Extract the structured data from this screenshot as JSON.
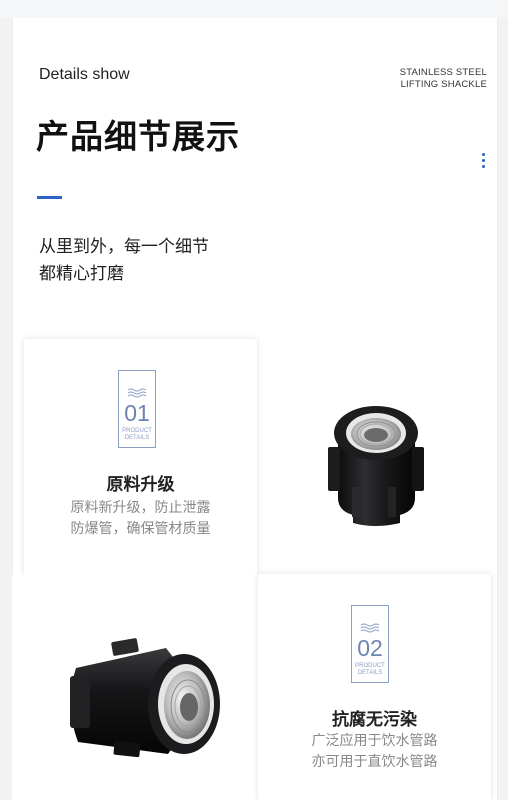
{
  "header": {
    "eyebrow": "Details show",
    "subtitle_line1": "STAINLESS STEEL",
    "subtitle_line2": "LIFTING SHACKLE",
    "title": "产品细节展示"
  },
  "tagline": {
    "line1": "从里到外，每一个细节",
    "line2": "都精心打磨"
  },
  "features": [
    {
      "number": "01",
      "caption_line1": "PRODUCT",
      "caption_line2": "DETAILS",
      "title": "原料升级",
      "desc_line1": "原料新升级，防止泄露",
      "desc_line2": "防爆管，确保管材质量"
    },
    {
      "number": "02",
      "caption_line1": "PRODUCT",
      "caption_line2": "DETAILS",
      "title": "抗腐无污染",
      "desc_line1": "广泛应用于饮水管路",
      "desc_line2": "亦可用于直饮水管路"
    }
  ],
  "colors": {
    "accent": "#2a63c9",
    "badge": "#6d84b3",
    "pipe": "#1b1b1d",
    "metal": "#c9c9c9"
  }
}
